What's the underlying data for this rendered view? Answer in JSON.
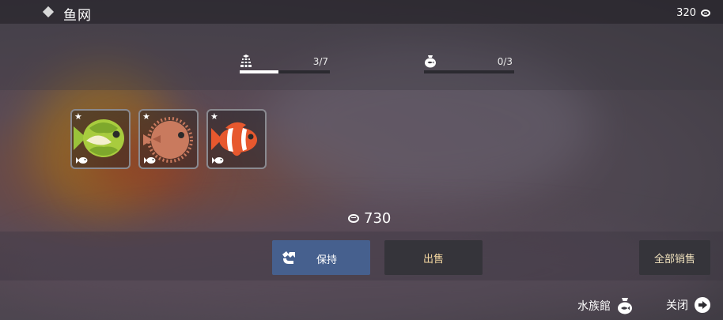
{
  "header": {
    "title": "鱼网",
    "currency": "320"
  },
  "stats": [
    {
      "icon": "net-icon",
      "value": "3/7",
      "progress": 0.43
    },
    {
      "icon": "bag-icon",
      "value": "0/3",
      "progress": 0
    }
  ],
  "catch": [
    {
      "name": "green-fish",
      "star": "★"
    },
    {
      "name": "pufferfish",
      "star": "★"
    },
    {
      "name": "clownfish",
      "star": "★"
    }
  ],
  "total_value": "730",
  "buttons": {
    "keep": "保持",
    "sell": "出售",
    "sell_all": "全部销售"
  },
  "footer": {
    "aquarium": "水族館",
    "close": "关闭"
  },
  "colors": {
    "keep_button": "#46608e",
    "sell_button": "#35343a",
    "sell_text": "#f3d6a0"
  }
}
